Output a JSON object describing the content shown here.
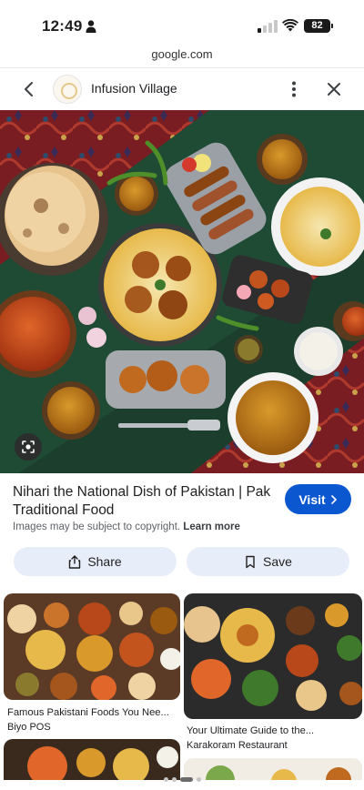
{
  "status_bar": {
    "time": "12:49",
    "battery": "82"
  },
  "browser": {
    "url": "google.com"
  },
  "header": {
    "site_name": "Infusion Village"
  },
  "result": {
    "title": "Nihari the National Dish of Pakistan | Pak Traditional Food",
    "visit_label": "Visit",
    "copyright_text": "Images may be subject to copyright.",
    "learn_more": "Learn more"
  },
  "actions": {
    "share_label": "Share",
    "save_label": "Save"
  },
  "related": [
    {
      "caption": "Famous Pakistani Foods You Nee...",
      "source": "Biyo POS"
    },
    {
      "caption": "Your Ultimate Guide to the...",
      "source": "Karakoram Restaurant"
    }
  ],
  "icons": [
    "person-icon",
    "signal-icon",
    "wifi-icon",
    "back-icon",
    "more-vert-icon",
    "close-icon",
    "lens-icon",
    "chevron-right-icon",
    "share-icon",
    "bookmark-icon"
  ],
  "colors": {
    "accent": "#0b57d0",
    "pill_bg": "#e8eef9"
  }
}
